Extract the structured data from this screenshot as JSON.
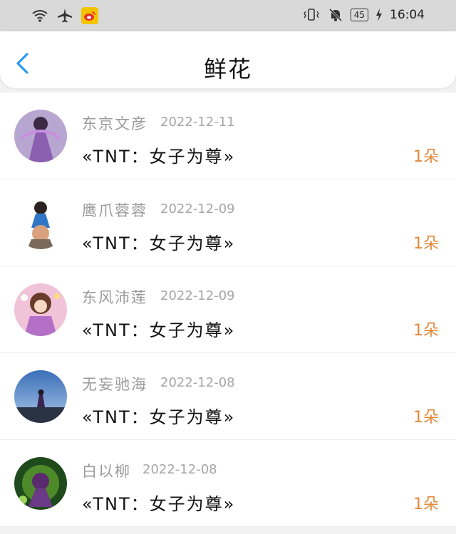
{
  "status": {
    "time": "16:04",
    "battery": "45"
  },
  "header": {
    "title": "鲜花"
  },
  "items": [
    {
      "name": "东京文彦",
      "date": "2022-12-11",
      "book": "«TNT：女子为尊»",
      "count": "1朵"
    },
    {
      "name": "鹰爪蓉蓉",
      "date": "2022-12-09",
      "book": "«TNT：女子为尊»",
      "count": "1朵"
    },
    {
      "name": "东风沛莲",
      "date": "2022-12-09",
      "book": "«TNT：女子为尊»",
      "count": "1朵"
    },
    {
      "name": "无妄驰海",
      "date": "2022-12-08",
      "book": "«TNT：女子为尊»",
      "count": "1朵"
    },
    {
      "name": "白以柳",
      "date": "2022-12-08",
      "book": "«TNT：女子为尊»",
      "count": "1朵"
    }
  ]
}
